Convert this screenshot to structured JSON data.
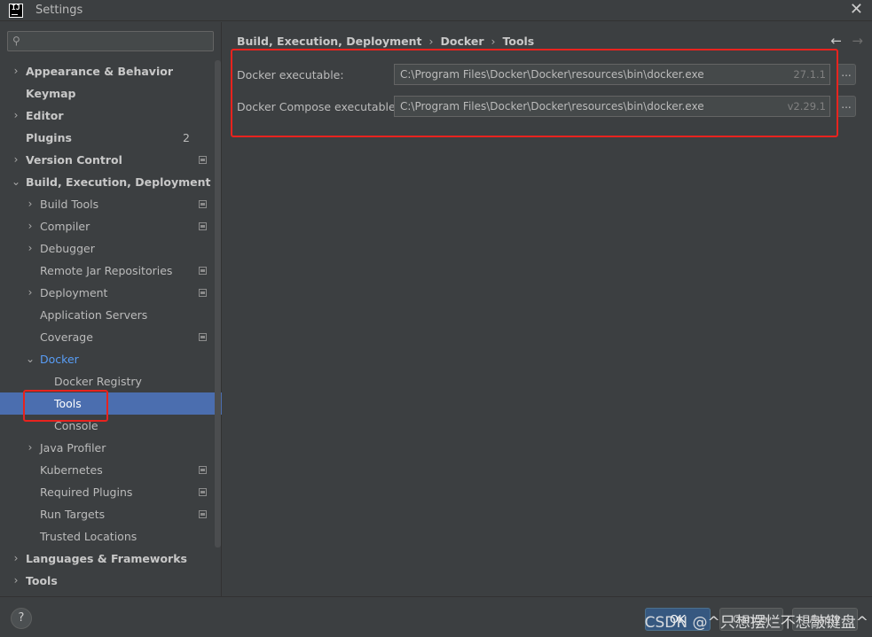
{
  "window": {
    "title": "Settings",
    "close_glyph": "✕"
  },
  "search": {
    "placeholder": "",
    "value": ""
  },
  "tree": [
    {
      "label": "Appearance & Behavior",
      "arrow": "›"
    },
    {
      "label": "Keymap"
    },
    {
      "label": "Editor",
      "arrow": "›"
    },
    {
      "label": "Plugins",
      "badge": "2"
    },
    {
      "label": "Version Control",
      "arrow": "›"
    },
    {
      "label": "Build, Execution, Deployment",
      "arrow": "⌄"
    },
    {
      "label": "Build Tools",
      "arrow": "›"
    },
    {
      "label": "Compiler",
      "arrow": "›"
    },
    {
      "label": "Debugger",
      "arrow": "›"
    },
    {
      "label": "Remote Jar Repositories"
    },
    {
      "label": "Deployment",
      "arrow": "›"
    },
    {
      "label": "Application Servers"
    },
    {
      "label": "Coverage"
    },
    {
      "label": "Docker",
      "arrow": "⌄"
    },
    {
      "label": "Docker Registry"
    },
    {
      "label": "Tools"
    },
    {
      "label": "Console"
    },
    {
      "label": "Java Profiler",
      "arrow": "›"
    },
    {
      "label": "Kubernetes"
    },
    {
      "label": "Required Plugins"
    },
    {
      "label": "Run Targets"
    },
    {
      "label": "Trusted Locations"
    },
    {
      "label": "Languages & Frameworks",
      "arrow": "›"
    },
    {
      "label": "Tools",
      "arrow": "›"
    }
  ],
  "breadcrumb": [
    "Build, Execution, Deployment",
    "Docker",
    "Tools"
  ],
  "breadcrumb_sep": "›",
  "nav": {
    "back": "←",
    "forward": "→"
  },
  "settings": {
    "docker_exe": {
      "label": "Docker executable:",
      "value": "C:\\Program Files\\Docker\\Docker\\resources\\bin\\docker.exe",
      "version": "27.1.1",
      "browse": "..."
    },
    "compose_exe": {
      "label": "Docker Compose executable:",
      "value": "C:\\Program Files\\Docker\\Docker\\resources\\bin\\docker.exe",
      "version": "v2.29.1",
      "browse": "..."
    }
  },
  "footer": {
    "help": "?",
    "ok": "OK",
    "cancel": "Cancel",
    "apply": "Apply",
    "watermark": "CSDN @^只想摆烂不想敲键盘^"
  },
  "colors": {
    "background": "#3c3f41",
    "selection": "#4b6eaf",
    "accent_link": "#589df6",
    "highlight": "#e8231e"
  }
}
